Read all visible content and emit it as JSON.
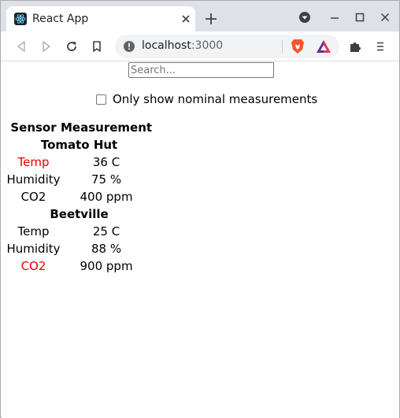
{
  "browser": {
    "tab_title": "React App",
    "url_host": "localhost",
    "url_port": ":3000"
  },
  "page": {
    "search_placeholder": "Search...",
    "filter_label": "Only show nominal measurements",
    "filter_checked": false,
    "table": {
      "headers": [
        "Sensor",
        "Measurement"
      ],
      "categories": [
        {
          "name": "Tomato Hut",
          "rows": [
            {
              "sensor": "Temp",
              "value": "36 C",
              "alert": true
            },
            {
              "sensor": "Humidity",
              "value": "75 %",
              "alert": false
            },
            {
              "sensor": "CO2",
              "value": "400 ppm",
              "alert": false
            }
          ]
        },
        {
          "name": "Beetville",
          "rows": [
            {
              "sensor": "Temp",
              "value": "25 C",
              "alert": false
            },
            {
              "sensor": "Humidity",
              "value": "88 %",
              "alert": false
            },
            {
              "sensor": "CO2",
              "value": "900 ppm",
              "alert": true
            }
          ]
        }
      ]
    }
  },
  "colors": {
    "alert": "#e60000",
    "tab_strip": "#dee1e6"
  },
  "icons": {
    "favicon": "react-icon",
    "tab_close": "close-icon",
    "new_tab": "plus-icon",
    "profile": "dropdown-circle-icon",
    "minimize": "minimize-icon",
    "maximize": "maximize-icon",
    "close_window": "close-window-icon",
    "back": "back-icon",
    "forward": "forward-icon",
    "reload": "reload-icon",
    "bookmark": "bookmark-icon",
    "site_info": "info-icon",
    "brave_shields": "brave-lion-icon",
    "brave_rewards": "brave-rewards-icon",
    "extensions": "puzzle-icon",
    "menu": "hamburger-menu-icon"
  }
}
